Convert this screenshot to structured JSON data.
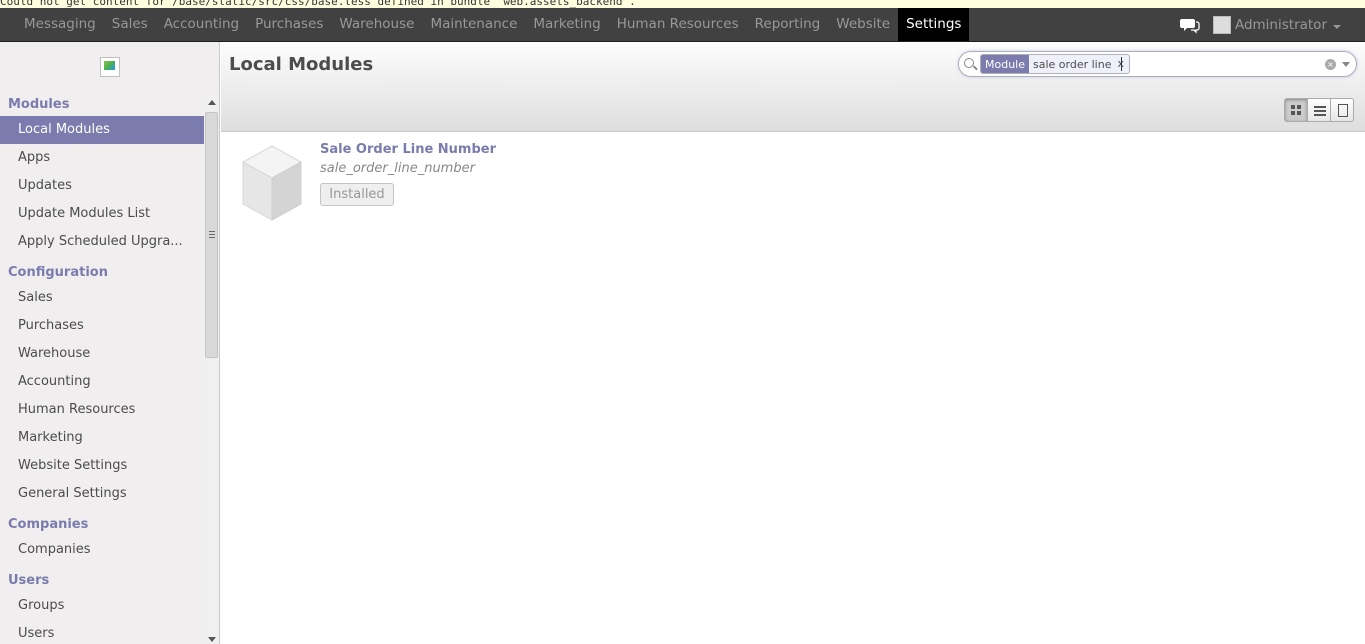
{
  "error_bar": {
    "text": "Could not get content for /base/static/src/css/base.less defined in bundle 'web.assets_backend'."
  },
  "top_menu": {
    "items": [
      "Messaging",
      "Sales",
      "Accounting",
      "Purchases",
      "Warehouse",
      "Maintenance",
      "Marketing",
      "Human Resources",
      "Reporting",
      "Website",
      "Settings"
    ],
    "active": "Settings"
  },
  "user": {
    "name": "Administrator"
  },
  "sidebar": {
    "sections": [
      {
        "title": "Modules",
        "items": [
          "Local Modules",
          "Apps",
          "Updates",
          "Update Modules List",
          "Apply Scheduled Upgra..."
        ]
      },
      {
        "title": "Configuration",
        "items": [
          "Sales",
          "Purchases",
          "Warehouse",
          "Accounting",
          "Human Resources",
          "Marketing",
          "Website Settings",
          "General Settings"
        ]
      },
      {
        "title": "Companies",
        "items": [
          "Companies"
        ]
      },
      {
        "title": "Users",
        "items": [
          "Groups",
          "Users"
        ]
      }
    ],
    "active_item": "Local Modules"
  },
  "page": {
    "title": "Local Modules"
  },
  "search": {
    "facet_category": "Module",
    "facet_value": "sale order line",
    "facet_remove": "x",
    "input_value": ""
  },
  "module": {
    "name": "Sale Order Line Number",
    "technical_name": "sale_order_line_number",
    "status_button": "Installed"
  },
  "colors": {
    "accent": "#7c7bad",
    "topbar": "#414141"
  }
}
